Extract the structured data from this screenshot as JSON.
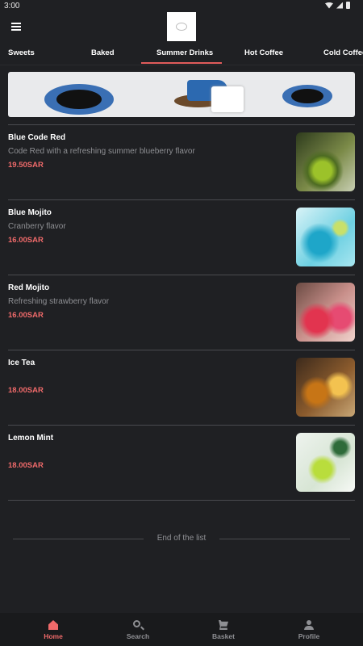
{
  "status_bar": {
    "time": "3:00"
  },
  "tabs": [
    {
      "label": "Sweets"
    },
    {
      "label": "Baked"
    },
    {
      "label": "Summer Drinks",
      "active": true
    },
    {
      "label": "Hot Coffee"
    },
    {
      "label": "Cold Coffee"
    }
  ],
  "items": [
    {
      "name": "Blue Code Red",
      "description": "Code Red with a refreshing summer blueberry flavor",
      "price": "19.50SAR"
    },
    {
      "name": "Blue Mojito",
      "description": "Cranberry flavor",
      "price": "16.00SAR"
    },
    {
      "name": "Red Mojito",
      "description": "Refreshing strawberry flavor",
      "price": "16.00SAR"
    },
    {
      "name": "Ice Tea",
      "description": "",
      "price": "18.00SAR"
    },
    {
      "name": "Lemon Mint",
      "description": "",
      "price": "18.00SAR"
    }
  ],
  "end_of_list": "End of the list",
  "bottom_nav": {
    "home": "Home",
    "search": "Search",
    "basket": "Basket",
    "profile": "Profile"
  },
  "colors": {
    "background": "#1f2023",
    "accent": "#ef6a6a",
    "muted_text": "#8e8f93"
  }
}
